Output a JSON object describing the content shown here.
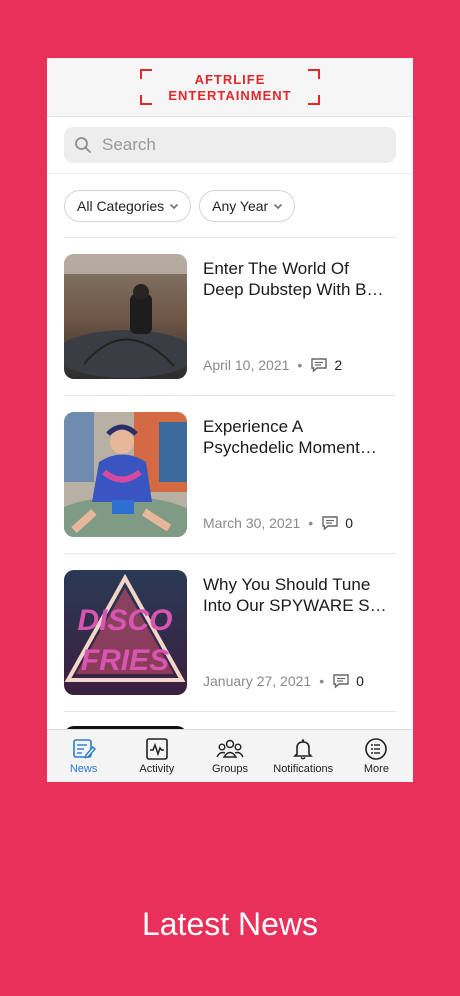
{
  "header": {
    "logo_line1": "AFTRLIFE",
    "logo_line2": "ENTERTAINMENT",
    "logo_color": "#E3272B"
  },
  "search": {
    "placeholder": "Search"
  },
  "filters": [
    {
      "label": "All Categories"
    },
    {
      "label": "Any Year"
    }
  ],
  "articles": [
    {
      "title_line1": "Enter The World Of",
      "title_line2": "Deep Dubstep With B…",
      "date": "April 10, 2021",
      "comments": "2"
    },
    {
      "title_line1": "Experience A",
      "title_line2": "Psychedelic Moment…",
      "date": "March 30, 2021",
      "comments": "0"
    },
    {
      "title_line1": "Why You Should Tune",
      "title_line2": "Into Our SPYWARE S…",
      "date": "January 27, 2021",
      "comments": "0"
    }
  ],
  "thumb3_text": {
    "line1": "DISCO",
    "line2": "FRIES"
  },
  "tabs": [
    {
      "label": "News",
      "icon": "news-icon",
      "active": true
    },
    {
      "label": "Activity",
      "icon": "activity-icon"
    },
    {
      "label": "Groups",
      "icon": "groups-icon"
    },
    {
      "label": "Notifications",
      "icon": "bell-icon"
    },
    {
      "label": "More",
      "icon": "more-list-icon"
    }
  ],
  "caption": "Latest News",
  "colors": {
    "background": "#E8305A",
    "accent": "#2A7CD3"
  }
}
